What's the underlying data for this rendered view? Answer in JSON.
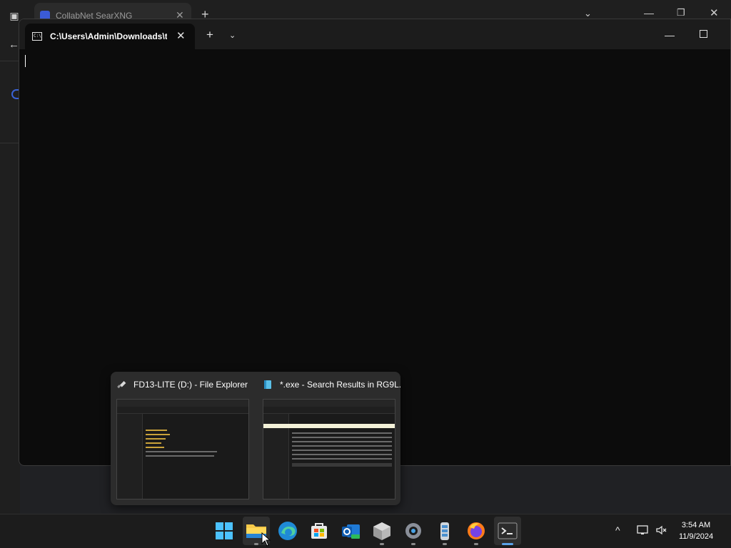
{
  "background_browser": {
    "tab_title": "CollabNet SearXNG",
    "tab_close": "✕",
    "new_tab": "+",
    "tab_list": "⌄",
    "minimize": "—",
    "restore": "❐",
    "close": "✕",
    "back": "←"
  },
  "terminal": {
    "tab_title": "C:\\Users\\Admin\\Downloads\\t",
    "tab_icon_text": "C:\\",
    "tab_close": "✕",
    "new_tab": "+",
    "dropdown": "⌄",
    "minimize": "—"
  },
  "taskbar_preview": {
    "items": [
      {
        "title": "FD13-LITE (D:) - File Explorer",
        "icon": "usb-drive-icon"
      },
      {
        "title": "*.exe - Search Results in RG9L...",
        "icon": "file-icon"
      }
    ]
  },
  "taskbar": {
    "apps": [
      {
        "name": "start",
        "icon": "windows-logo-icon"
      },
      {
        "name": "file-explorer",
        "icon": "folder-icon",
        "active": true
      },
      {
        "name": "edge",
        "icon": "edge-icon"
      },
      {
        "name": "store",
        "icon": "store-icon"
      },
      {
        "name": "outlook",
        "icon": "outlook-icon"
      },
      {
        "name": "box-app",
        "icon": "box-icon"
      },
      {
        "name": "settings",
        "icon": "gear-icon"
      },
      {
        "name": "sysinfo",
        "icon": "battery-db-icon"
      },
      {
        "name": "firefox",
        "icon": "firefox-icon"
      },
      {
        "name": "terminal",
        "icon": "terminal-icon",
        "active": true
      }
    ],
    "tray": {
      "chevron": "^",
      "time": "3:54 AM",
      "date": "11/9/2024"
    }
  },
  "colors": {
    "accent": "#3a62d6",
    "taskbar": "#1c1c1c",
    "terminal_bg": "#0c0c0c"
  }
}
